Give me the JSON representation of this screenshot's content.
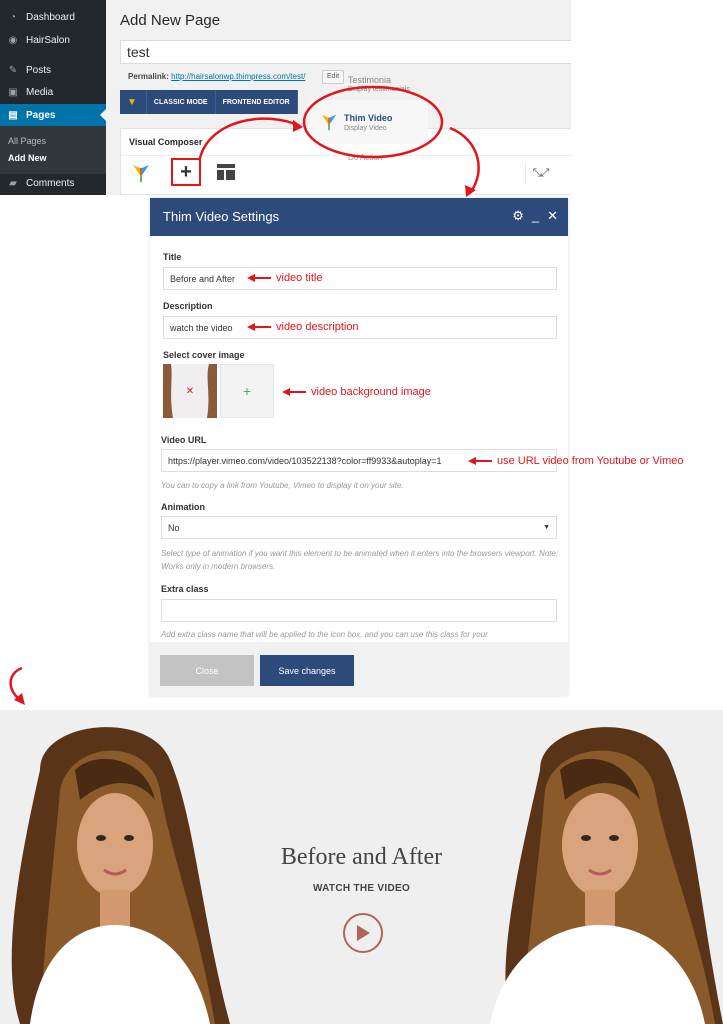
{
  "wp_admin": {
    "menu": [
      {
        "label": "Dashboard",
        "icon": "dashboard-icon"
      },
      {
        "label": "HairSalon",
        "icon": "hairsalon-icon"
      },
      {
        "label": "Posts",
        "icon": "pin-icon"
      },
      {
        "label": "Media",
        "icon": "media-icon"
      },
      {
        "label": "Pages",
        "icon": "pages-icon",
        "active": true
      },
      {
        "label": "Comments",
        "icon": "comment-icon"
      }
    ],
    "submenu": [
      {
        "label": "All Pages"
      },
      {
        "label": "Add New",
        "current": true
      }
    ],
    "accent_color": "#0073aa"
  },
  "editor": {
    "heading": "Add New Page",
    "page_title": "test",
    "permalink_label": "Permalink:",
    "permalink_url": "http://hairsalonwp.thimpress.com/test/",
    "edit_label": "Edit",
    "classic_mode": "CLASSIC MODE",
    "frontend_editor": "FRONTEND EDITOR",
    "vc_panel_title": "Visual Composer"
  },
  "element_picker": {
    "faded_top": "Testimonia",
    "faded_sub": "Display testimonials",
    "faded_bottom": "Do Action",
    "item": {
      "name": "Thim Video",
      "description": "Display Video"
    }
  },
  "modal": {
    "title": "Thim Video Settings",
    "header_color": "#2c4a7a",
    "fields": {
      "title_label": "Title",
      "title_value": "Before and After",
      "description_label": "Description",
      "description_value": "watch the video",
      "cover_label": "Select cover image",
      "url_label": "Video URL",
      "url_value": "https://player.vimeo.com/video/103522138?color=ff9933&autoplay=1",
      "url_help": "You can to copy a link from Youtube, Vimeo to display it on your site.",
      "animation_label": "Animation",
      "animation_value": "No",
      "animation_help": "Select type of animation if you want this element to be animated when it enters into the browsers viewport. Note: Works only in modern browsers.",
      "extra_label": "Extra class",
      "extra_value": "",
      "extra_help": "Add extra class name that will be applied to the icon box, and you can use this class for your"
    },
    "close_label": "Close",
    "save_label": "Save changes"
  },
  "annotations": {
    "title_note": "video title",
    "description_note": "video description",
    "image_note": "video background image",
    "url_note": "use URL video from Youtube or Vimeo",
    "color": "#e0161b"
  },
  "preview": {
    "title": "Before and After",
    "subtitle": "WATCH THE VIDEO"
  }
}
